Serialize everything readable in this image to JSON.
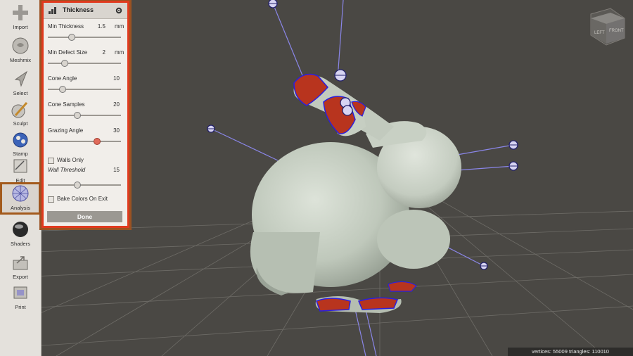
{
  "toolbar": {
    "items": [
      {
        "label": "Import",
        "icon": "plus-icon"
      },
      {
        "label": "Meshmix",
        "icon": "meshmix-icon"
      },
      {
        "label": "Select",
        "icon": "select-arrow-icon"
      },
      {
        "label": "Sculpt",
        "icon": "brush-icon"
      },
      {
        "label": "Stamp",
        "icon": "stamp-icon"
      },
      {
        "label": "Edit",
        "icon": "edit-icon"
      },
      {
        "label": "Analysis",
        "icon": "analysis-sphere-icon"
      },
      {
        "label": "Shaders",
        "icon": "shader-sphere-icon"
      },
      {
        "label": "Export",
        "icon": "export-icon"
      },
      {
        "label": "Print",
        "icon": "printer-icon"
      }
    ],
    "active": "Analysis"
  },
  "panel": {
    "title": "Thickness",
    "params": [
      {
        "label": "Min Thickness",
        "value": "1.5",
        "unit": "mm",
        "fraction": 0.33
      },
      {
        "label": "Min Defect Size",
        "value": "2",
        "unit": "mm",
        "fraction": 0.23
      },
      {
        "label": "Cone Angle",
        "value": "10",
        "unit": "",
        "fraction": 0.2
      },
      {
        "label": "Cone Samples",
        "value": "20",
        "unit": "",
        "fraction": 0.4
      },
      {
        "label": "Grazing Angle",
        "value": "30",
        "unit": "",
        "fraction": 0.67
      }
    ],
    "walls_only": "Walls Only",
    "wall_threshold": {
      "label": "Wall Threshold",
      "value": "15",
      "fraction": 0.4
    },
    "bake_colors": "Bake Colors On Exit",
    "done": "Done"
  },
  "viewcube": {
    "left": "LEFT",
    "front": "FRONT"
  },
  "status": "vertices: 55009 triangles: 110010",
  "colors": {
    "toolbar_bg": "#e4e1dc",
    "panel_border": "#e03a1e",
    "active_tool_outline": "#a35a1c",
    "viewport_bg": "#4a4844",
    "mesh": "#c9d1c6",
    "defect_fill": "#b8341e",
    "defect_outline": "#2a1fe0",
    "ray_line": "#8a86e8"
  }
}
